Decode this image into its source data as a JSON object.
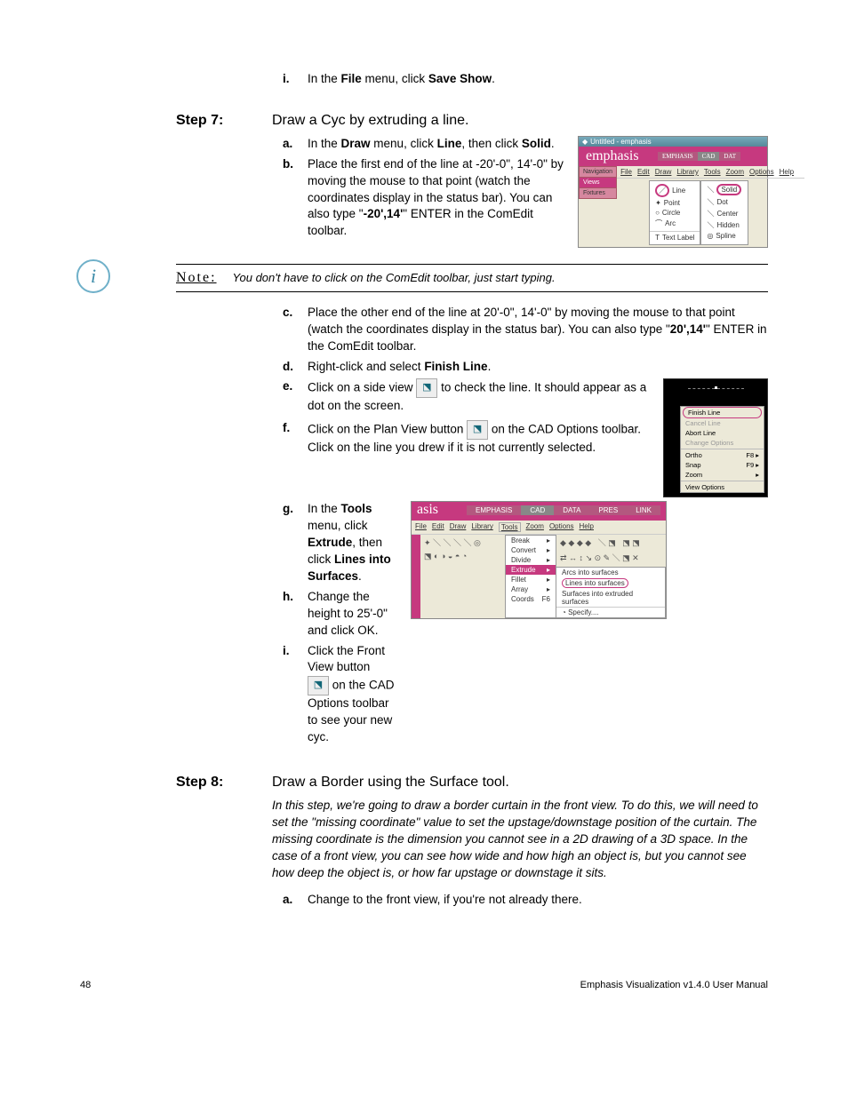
{
  "pre_step": {
    "i": {
      "marker": "i.",
      "t1": "In the ",
      "b1": "File",
      "t2": " menu, click ",
      "b2": "Save Show",
      "t3": "."
    }
  },
  "step7": {
    "label": "Step 7:",
    "title": "Draw a Cyc by extruding a line.",
    "a": {
      "marker": "a.",
      "t1": "In the ",
      "b1": "Draw",
      "t2": " menu, click ",
      "b2": "Line",
      "t3": ", then click ",
      "b3": "Solid",
      "t4": "."
    },
    "b": {
      "marker": "b.",
      "t1": "Place the first end of the line at -20'-0\", 14'-0\" by moving the mouse to that point (watch the coordinates display in the status bar). You can also type \"",
      "b1": "-20',14'",
      "t2": "\" ENTER in the ComEdit toolbar."
    },
    "note_label": "Note:",
    "note_text": "You don't have to click on the ComEdit toolbar, just start typing.",
    "c": {
      "marker": "c.",
      "t1": "Place the other end of the line at 20'-0\", 14'-0\" by moving the mouse to that point (watch the coordinates display in the status bar). You can also type \"",
      "b1": "20',14'",
      "t2": "\" ENTER in the ComEdit toolbar."
    },
    "d": {
      "marker": "d.",
      "t1": "Right-click and select ",
      "b1": "Finish Line",
      "t2": "."
    },
    "e": {
      "marker": "e.",
      "t1": "Click on a side view ",
      "t2": " to check the line. It should appear as a dot on the screen."
    },
    "f": {
      "marker": "f.",
      "t1": "Click on the Plan View button ",
      "t2": " on the CAD Options toolbar. Click on the line you drew if it is not currently selected."
    },
    "g": {
      "marker": "g.",
      "t1": "In the ",
      "b1": "Tools",
      "t2": " menu, click ",
      "b2": "Extrude",
      "t3": ", then click ",
      "b3": "Lines into Surfaces",
      "t4": "."
    },
    "h": {
      "marker": "h.",
      "t1": "Change the height to 25'-0\" and click OK."
    },
    "i": {
      "marker": "i.",
      "t1": "Click the Front View button ",
      "t2": " on the CAD Options toolbar to see your new cyc."
    }
  },
  "ss1": {
    "title_prefix": "Untitled - emphasis",
    "logo": "emphasis",
    "tabs": [
      "EMPHASIS",
      "CAD",
      "DAT"
    ],
    "sidebar": [
      "Navigation",
      "Views",
      "Fixtures"
    ],
    "menus": [
      "File",
      "Edit",
      "Draw",
      "Library",
      "Tools",
      "Zoom",
      "Options",
      "Help"
    ],
    "col1": [
      {
        "icon": "／",
        "label": "Line"
      },
      {
        "icon": "✦",
        "label": "Point"
      },
      {
        "icon": "○",
        "label": "Circle"
      },
      {
        "icon": "⌒",
        "label": "Arc"
      },
      {
        "icon": "T",
        "label": "Text Label"
      }
    ],
    "col2": [
      {
        "icon": "＼",
        "label": "Solid",
        "hl": true
      },
      {
        "icon": "＼",
        "label": "Dot"
      },
      {
        "icon": "＼",
        "label": "Center"
      },
      {
        "icon": "＼",
        "label": "Hidden"
      },
      {
        "icon": "◎",
        "label": "Spline"
      }
    ]
  },
  "ss2": {
    "items": [
      {
        "label": "Finish Line",
        "hl": true
      },
      {
        "label": "Cancel Line",
        "gray": true
      },
      {
        "label": "Abort Line"
      },
      {
        "label": "Change Options",
        "gray": true
      }
    ],
    "items2": [
      {
        "label": "Ortho",
        "kb": "F8 ▸"
      },
      {
        "label": "Snap",
        "kb": "F9 ▸"
      },
      {
        "label": "Zoom",
        "kb": "▸"
      }
    ],
    "items3": [
      {
        "label": "View Options"
      }
    ]
  },
  "ss3": {
    "logo": "asis",
    "tabs": [
      "EMPHASIS",
      "CAD",
      "DATA",
      "PRES",
      "LINK"
    ],
    "menus": [
      "File",
      "Edit",
      "Draw",
      "Library",
      "Tools",
      "Zoom",
      "Options",
      "Help"
    ],
    "dd": [
      {
        "label": "Break",
        "arrow": "▸"
      },
      {
        "label": "Convert",
        "arrow": "▸"
      },
      {
        "label": "Divide",
        "arrow": "▸"
      },
      {
        "label": "Extrude",
        "arrow": "▸",
        "hl": true
      },
      {
        "label": "Fillet",
        "arrow": "▸"
      },
      {
        "label": "Array",
        "arrow": "▸"
      },
      {
        "label": "Coords",
        "arrow": "F6"
      }
    ],
    "sub": [
      {
        "label": "Arcs into surfaces"
      },
      {
        "label": "Lines into surfaces",
        "hl": true
      },
      {
        "label": "Surfaces into extruded surfaces"
      },
      {
        "label": "Specify....",
        "icon": "◔"
      }
    ]
  },
  "step8": {
    "label": "Step 8:",
    "title": "Draw a Border using the Surface tool.",
    "intro": "In this step, we're going to draw a border curtain in the front view. To do this, we will need to set the \"missing coordinate\" value to set the upstage/downstage position of the curtain. The missing coordinate is the dimension you cannot see in a 2D drawing of a 3D space. In the case of a front view, you can see how wide and how high an object is, but you cannot see how deep the object is, or how far upstage or downstage it sits.",
    "a": {
      "marker": "a.",
      "t1": "Change to the front view, if you're not already there."
    }
  },
  "footer": {
    "page": "48",
    "doc": "Emphasis Visualization v1.4.0 User Manual"
  }
}
